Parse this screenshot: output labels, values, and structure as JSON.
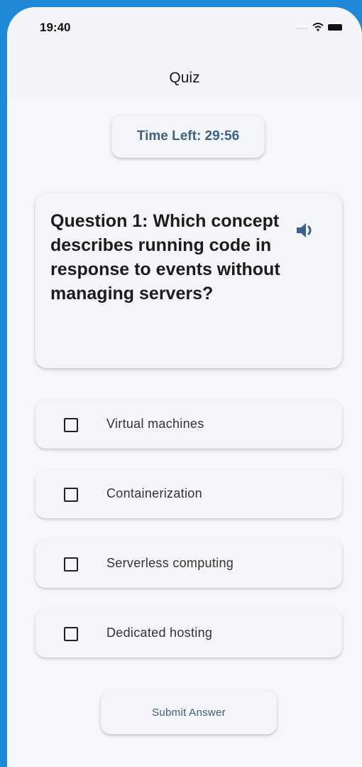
{
  "status_bar": {
    "time": "19:40"
  },
  "app_bar": {
    "title": "Quiz"
  },
  "timer": {
    "label": "Time Left: 29:56"
  },
  "question": {
    "text": "Question 1: Which concept describes running code in response to events without managing servers?",
    "audio_icon": "speaker-icon"
  },
  "options": [
    {
      "label": "Virtual machines",
      "checked": false
    },
    {
      "label": "Containerization",
      "checked": false
    },
    {
      "label": "Serverless computing",
      "checked": false
    },
    {
      "label": "Dedicated hosting",
      "checked": false
    }
  ],
  "submit": {
    "label": "Submit Answer"
  },
  "colors": {
    "accent": "#3e6189",
    "background": "#f6f7fb",
    "frame": "#1f88d8"
  }
}
